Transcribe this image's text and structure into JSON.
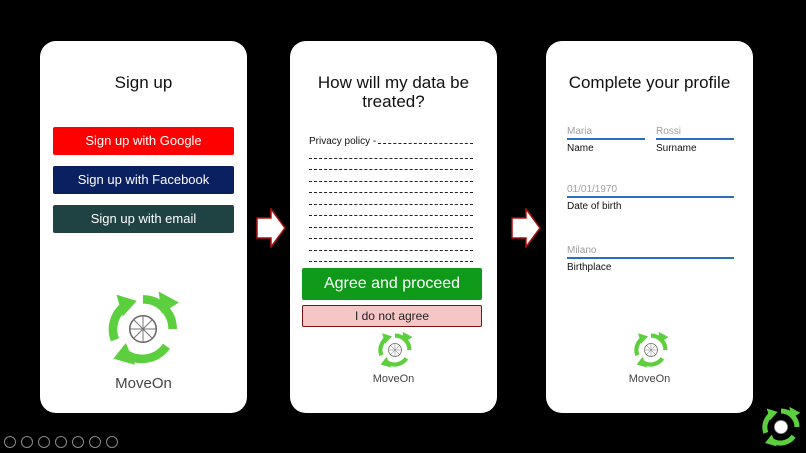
{
  "signup": {
    "title": "Sign up",
    "google": "Sign up with Google",
    "facebook": "Sign up with Facebook",
    "email": "Sign up with email",
    "brand": "MoveOn"
  },
  "privacy": {
    "title_line1": "How will my data be",
    "title_line2": "treated?",
    "policy_label": "Privacy policy -",
    "agree": "Agree and proceed",
    "disagree": "I do not agree",
    "brand": "MoveOn"
  },
  "profile": {
    "title": "Complete your profile",
    "name_value": "Maria",
    "name_label": "Name",
    "surname_value": "Rossi",
    "surname_label": "Surname",
    "dob_value": "01/01/1970",
    "dob_label": "Date of birth",
    "birthplace_value": "Milano",
    "birthplace_label": "Birthplace",
    "brand": "MoveOn"
  },
  "colors": {
    "google": "#ff0000",
    "facebook": "#0a2060",
    "email": "#1f4242",
    "agree": "#0f9a1a",
    "disagree": "#f5c6c6",
    "field_line": "#2a6ec0",
    "logo_green": "#5ccf3e"
  }
}
